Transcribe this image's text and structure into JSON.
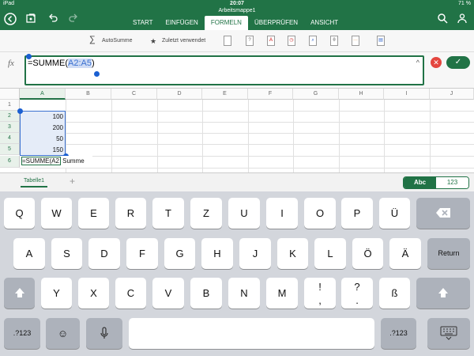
{
  "status": {
    "device": "iPad",
    "time": "20:07",
    "battery": "71 %"
  },
  "document_title": "Arbeitsmappe1",
  "tabs": [
    {
      "label": "START",
      "active": false
    },
    {
      "label": "EINFÜGEN",
      "active": false
    },
    {
      "label": "FORMELN",
      "active": true
    },
    {
      "label": "ÜBERPRÜFEN",
      "active": false
    },
    {
      "label": "ANSICHT",
      "active": false
    }
  ],
  "toolbar": {
    "autosum_label": "AutoSumme",
    "recent_label": "Zuletzt verwendet"
  },
  "formula": {
    "fx_label": "fx",
    "prefix": "=SUMME(",
    "ref": "A2:A5",
    "suffix": ")"
  },
  "columns": [
    "A",
    "B",
    "C",
    "D",
    "E",
    "F",
    "G",
    "H",
    "I",
    "J"
  ],
  "rows": [
    "1",
    "2",
    "3",
    "4",
    "5",
    "6"
  ],
  "cells": {
    "A2": "100",
    "A3": "200",
    "A4": "50",
    "A5": "150"
  },
  "edit_cell": {
    "value": "=SUMME(A2",
    "hint": "Summe"
  },
  "sheet": {
    "tab": "Tabelle1",
    "add": "+"
  },
  "keyboard_mode": {
    "abc": "Abc",
    "num": "123"
  },
  "keyboard": {
    "row1": [
      "Q",
      "W",
      "E",
      "R",
      "T",
      "Z",
      "U",
      "I",
      "O",
      "P",
      "Ü"
    ],
    "row2": [
      "A",
      "S",
      "D",
      "F",
      "G",
      "H",
      "J",
      "K",
      "L",
      "Ö",
      "Ä"
    ],
    "row3": [
      "Y",
      "X",
      "C",
      "V",
      "B",
      "N",
      "M"
    ],
    "return_label": "Return",
    "sym_label": ".?123",
    "excl": "!",
    "comma": ",",
    "quest": "?",
    "period": ".",
    "eszett": "ß"
  },
  "accent_color": "#217346"
}
